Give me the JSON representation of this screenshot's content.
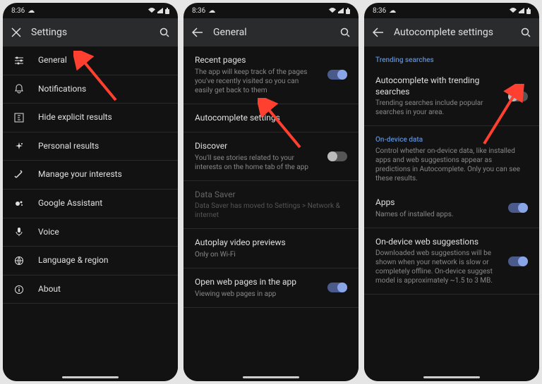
{
  "status": {
    "time": "8:36",
    "icons": "☁"
  },
  "screen1": {
    "title": "Settings",
    "items": [
      {
        "icon": "sliders",
        "label": "General"
      },
      {
        "icon": "bell",
        "label": "Notifications"
      },
      {
        "icon": "explicit",
        "label": "Hide explicit results"
      },
      {
        "icon": "sparkle",
        "label": "Personal results"
      },
      {
        "icon": "wand",
        "label": "Manage your interests"
      },
      {
        "icon": "assistant",
        "label": "Google Assistant"
      },
      {
        "icon": "mic",
        "label": "Voice"
      },
      {
        "icon": "globe",
        "label": "Language & region"
      },
      {
        "icon": "info",
        "label": "About"
      }
    ]
  },
  "screen2": {
    "title": "General",
    "items": [
      {
        "label": "Recent pages",
        "sub": "The app will keep track of the pages you've recently visited so you can easily get back to them",
        "toggle": "on"
      },
      {
        "label": "Autocomplete settings"
      },
      {
        "label": "Discover",
        "sub": "You'll see stories related to your interests on the home tab of the app",
        "toggle": "off"
      },
      {
        "label": "Data Saver",
        "sub": "Data Saver has moved to Settings > Network & internet",
        "disabled": true
      },
      {
        "label": "Autoplay video previews",
        "sub": "Only on Wi-Fi"
      },
      {
        "label": "Open web pages in the app",
        "sub": "Viewing web pages in app",
        "toggle": "on"
      }
    ]
  },
  "screen3": {
    "title": "Autocomplete settings",
    "section1": {
      "header": "Trending searches",
      "items": [
        {
          "label": "Autocomplete with trending searches",
          "sub": "Trending searches include popular searches in your area.",
          "toggle": "off"
        }
      ]
    },
    "section2": {
      "header": "On-device data",
      "desc": "Control whether on-device data, like installed apps and web suggestions appear as predictions in Autocomplete. Only you can see these results.",
      "items": [
        {
          "label": "Apps",
          "sub": "Names of installed apps.",
          "toggle": "on"
        },
        {
          "label": "On-device web suggestions",
          "sub": "Downloaded web suggestions will be shown when your network is slow or completely offline. On-device suggest model is approximately ~1.5 to 3 MB.",
          "toggle": "on"
        }
      ]
    }
  }
}
